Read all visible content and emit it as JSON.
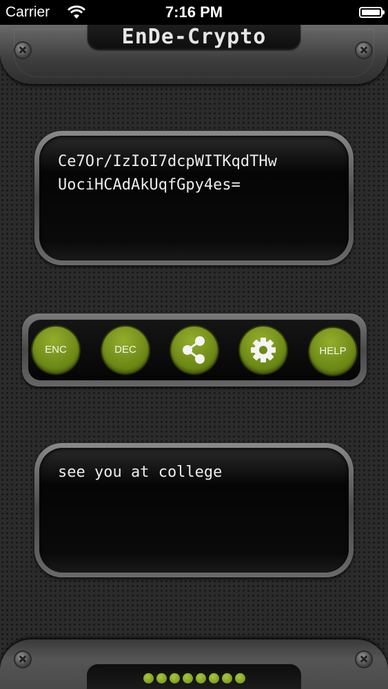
{
  "status_bar": {
    "carrier": "Carrier",
    "time": "7:16 PM"
  },
  "header": {
    "title": "EnDe-Crypto"
  },
  "output_panel": {
    "line1": "Ce7Or/IzIoI7dcpWITKqdTHw",
    "line2": "UociHCAdAkUqfGpy4es="
  },
  "toolbar": {
    "enc_label": "ENC",
    "dec_label": "DEC",
    "share_icon": "share-icon",
    "settings_icon": "gear-icon",
    "help_label": "HELP"
  },
  "input_panel": {
    "text": "see you at college"
  },
  "page_indicator": {
    "dot_count": 8
  },
  "colors": {
    "accent_green": "#7a961e",
    "background": "#2b2b2b",
    "panel_dark": "#0a0a0a"
  }
}
